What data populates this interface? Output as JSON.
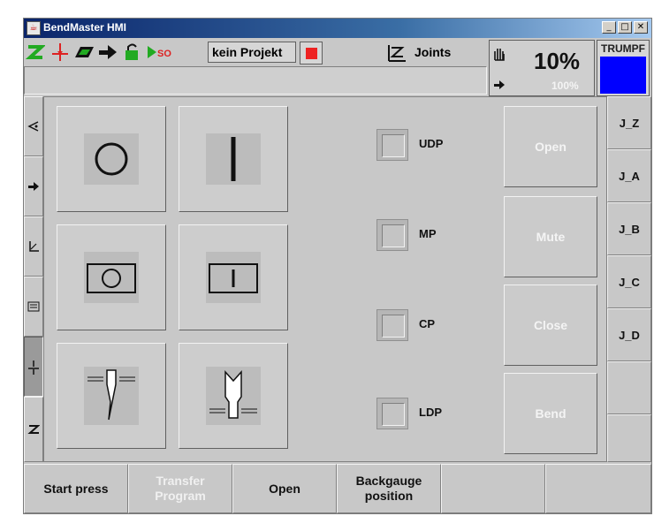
{
  "window": {
    "title": "BendMaster HMI"
  },
  "header": {
    "project_label": "kein Projekt",
    "joints_label": "Joints",
    "speed_percent": "10%",
    "speed_max": "100%",
    "brand": "TRUMPF"
  },
  "symbols": [
    {
      "name": "circle"
    },
    {
      "name": "bar"
    },
    {
      "name": "circle-frame"
    },
    {
      "name": "bar-frame"
    },
    {
      "name": "punch"
    },
    {
      "name": "die"
    }
  ],
  "checks": [
    {
      "label": "UDP",
      "checked": false
    },
    {
      "label": "MP",
      "checked": false
    },
    {
      "label": "CP",
      "checked": false
    },
    {
      "label": "LDP",
      "checked": false
    }
  ],
  "actions": [
    {
      "label": "Open"
    },
    {
      "label": "Mute"
    },
    {
      "label": "Close"
    },
    {
      "label": "Bend"
    }
  ],
  "joints": [
    {
      "label": "J_Z"
    },
    {
      "label": "J_A"
    },
    {
      "label": "J_B"
    },
    {
      "label": "J_C"
    },
    {
      "label": "J_D"
    }
  ],
  "bottom": {
    "start_press": "Start press",
    "transfer_program": "Transfer Program",
    "open": "Open",
    "backgauge_position": "Backgauge position"
  },
  "colors": {
    "title_bar": "#0a246a",
    "brand_box": "#0000ff",
    "stop": "#ee2222",
    "green_icon": "#22aa22"
  }
}
